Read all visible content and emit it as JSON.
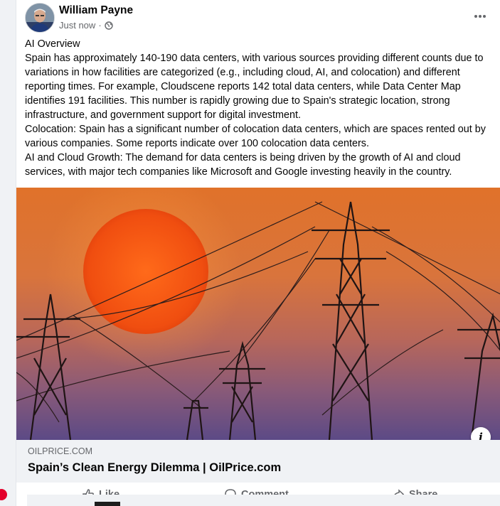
{
  "post": {
    "author": "William Payne",
    "timestamp": "Just now",
    "separator": "·",
    "privacy_icon": "globe-icon",
    "more_icon": "ellipsis-icon",
    "paragraphs": [
      "AI Overview",
      "Spain has approximately 140-190 data centers, with various sources providing different counts due to variations in how facilities are categorized (e.g., including cloud, AI, and colocation) and different reporting times. For example, Cloudscene reports 142 total data centers, while Data Center Map identifies 191 facilities. This number is rapidly growing due to Spain's strategic location, strong infrastructure, and government support for digital investment.",
      "Colocation: Spain has a significant number of colocation data centers, which are spaces rented out by various companies. Some reports indicate over 100 colocation data centers.",
      "AI and Cloud Growth: The demand for data centers is being driven by the growth of AI and cloud services, with major tech companies like Microsoft and Google investing heavily in the country."
    ]
  },
  "link": {
    "domain": "OILPRICE.COM",
    "title": "Spain’s Clean Energy Dilemma | OilPrice.com",
    "info_icon": "info-icon"
  },
  "actions": {
    "like": "Like",
    "comment": "Comment",
    "share": "Share"
  },
  "colors": {
    "accent": "#e4002b",
    "card_bg": "#f0f2f5",
    "meta_text": "#65676b"
  }
}
